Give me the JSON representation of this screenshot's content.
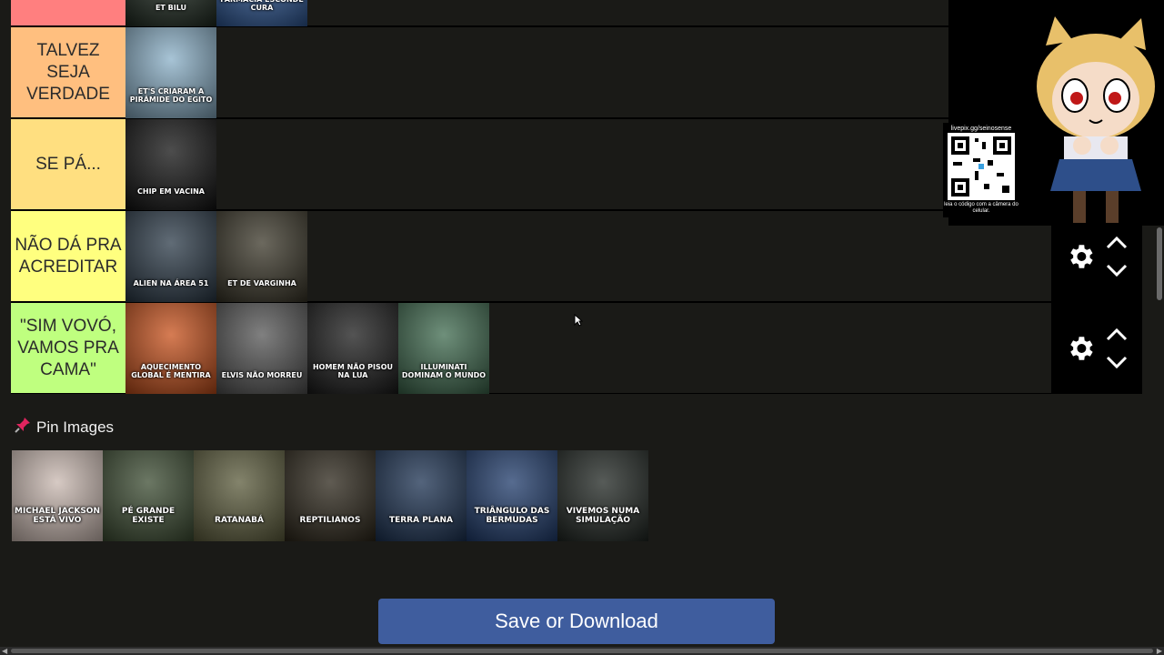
{
  "tiers": [
    {
      "label": "",
      "color": "#ff7f7f",
      "items": [
        {
          "caption": "ET BILU",
          "bg": "#1e2a20"
        },
        {
          "caption": "INDÚSTRIA DA FARMÁCIA ESCONDE CURA",
          "bg": "#2f5a9a"
        }
      ],
      "controls_visible": false
    },
    {
      "label": "TALVEZ SEJA VERDADE",
      "color": "#ffbf7f",
      "items": [
        {
          "caption": "ET'S CRIARAM A PIRÂMIDE DO EGITO",
          "bg": "#8ab0c8"
        }
      ],
      "controls_visible": false
    },
    {
      "label": "SE PÁ...",
      "color": "#ffdf80",
      "items": [
        {
          "caption": "CHIP EM VACINA",
          "bg": "#111"
        }
      ],
      "controls_visible": false
    },
    {
      "label": "NÃO DÁ PRA ACREDITAR",
      "color": "#ffff7f",
      "items": [
        {
          "caption": "ALIEN NA ÁREA 51",
          "bg": "#2b3a48"
        },
        {
          "caption": "ET DE VARGINHA",
          "bg": "#3a3628"
        }
      ],
      "controls_visible": true
    },
    {
      "label": "\"SIM VOVÓ, VAMOS PRA CAMA\"",
      "color": "#bfff7f",
      "items": [
        {
          "caption": "AQUECIMENTO GLOBAL É MENTIRA",
          "bg": "#c8501a"
        },
        {
          "caption": "ELVIS NÃO MORREU",
          "bg": "#555"
        },
        {
          "caption": "HOMEM NÃO PISOU NA LUA",
          "bg": "#1a1a1a"
        },
        {
          "caption": "ILLUMINATI DOMINAM O MUNDO",
          "bg": "#3e6a4e"
        }
      ],
      "controls_visible": true
    }
  ],
  "pin_images": {
    "title": "Pin Images",
    "items": [
      {
        "caption": "MICHAEL JACKSON ESTÁ VIVO",
        "bg": "#c9b8b0"
      },
      {
        "caption": "PÉ GRANDE EXISTE",
        "bg": "#3a4a30"
      },
      {
        "caption": "RATANABÁ",
        "bg": "#5a5a3a"
      },
      {
        "caption": "REPTILIANOS",
        "bg": "#2a2418"
      },
      {
        "caption": "TERRA PLANA",
        "bg": "#1a3050"
      },
      {
        "caption": "TRIÂNGULO DAS BERMUDAS",
        "bg": "#1e3a6a"
      },
      {
        "caption": "VIVEMOS NUMA SIMULAÇÃO",
        "bg": "#1e2420"
      }
    ]
  },
  "save_button": "Save or Download",
  "overlay": {
    "qr_url": "livepix.gg/seinosense",
    "qr_note": "leia o código com a câmera do celular."
  },
  "colors": {
    "page_bg": "#1a1a17",
    "button_bg": "#3f5d9e"
  }
}
